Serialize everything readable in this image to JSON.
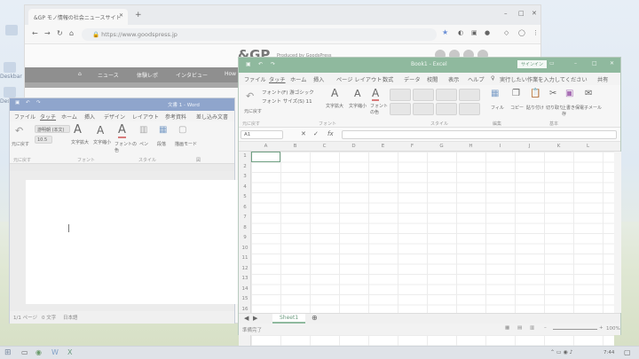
{
  "desktop": {
    "icons": [
      "Deskbar",
      "Deskbar"
    ]
  },
  "browser": {
    "tab_title": "&GP モノ情報の社会ニュースサイト",
    "url": "https://www.goodspress.jp",
    "logo": "&GP",
    "logo_sub": "Produced by GoodsPress",
    "nav": [
      "ニュース",
      "体験レポ",
      "インタビュー",
      "How"
    ]
  },
  "word": {
    "title": "文書 1 - Word",
    "menu": [
      "ファイル",
      "タッチ",
      "ホーム",
      "挿入",
      "デザイン",
      "レイアウト",
      "参考資料",
      "差し込み文書"
    ],
    "ribbon": [
      "元に戻す",
      "游明朝 (本文)",
      "10.5",
      "文字拡大",
      "文字縮小",
      "フォントの色",
      "ペン",
      "段落",
      "描画モード"
    ],
    "groups": [
      "元に戻す",
      "フォント",
      "スタイル",
      "図"
    ],
    "status": [
      "1/1 ページ",
      "0 文字",
      "日本語"
    ]
  },
  "excel": {
    "title": "Book1 - Excel",
    "signin": "サインイン",
    "menu": [
      "ファイル",
      "タッチ",
      "ホーム",
      "挿入",
      "ページ レイアウト",
      "数式",
      "データ",
      "校閲",
      "表示",
      "ヘルプ"
    ],
    "tellme": "実行したい作業を入力してください",
    "share": "共有",
    "ribbon": [
      "元に戻す",
      "フォント(F) 游ゴシック",
      "フォント サイズ(S) 11",
      "文字拡大",
      "文字縮小",
      "フォントの色",
      "フィル",
      "コピー",
      "貼り付け",
      "切り取り",
      "上書き保存",
      "電子メール"
    ],
    "groups": [
      "元に戻す",
      "フォント",
      "スタイル",
      "編集",
      "基本"
    ],
    "name_box": "A1",
    "fx": "fx",
    "columns": [
      "A",
      "B",
      "C",
      "D",
      "E",
      "F",
      "G",
      "H",
      "I",
      "J",
      "K",
      "L"
    ],
    "rows": [
      "1",
      "2",
      "3",
      "4",
      "5",
      "6",
      "7",
      "8",
      "9",
      "10",
      "11",
      "12",
      "13",
      "14",
      "15",
      "16"
    ],
    "sheet_tab": "Sheet1",
    "status": "準備完了",
    "zoom": "100%"
  },
  "taskbar": {
    "time": "7:44"
  }
}
